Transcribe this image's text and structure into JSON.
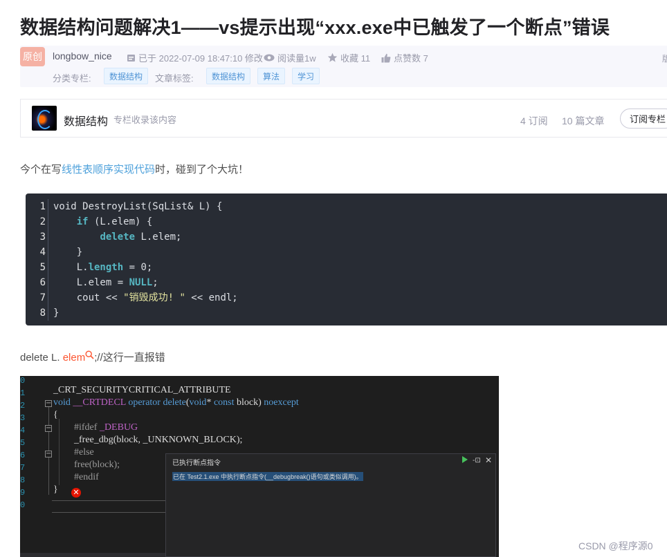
{
  "article": {
    "title": "数据结构问题解决1——vs提示出现“xxx.exe中已触发了一个断点”错误"
  },
  "meta": {
    "badge": "原创",
    "author": "longbow_nice",
    "date_label": "已于 2022-07-09 18:47:10 修改",
    "views_label": "阅读量1w",
    "favorites_label": "收藏 11",
    "likes_label": "点赞数 7",
    "edge_label": "版",
    "category_label": "分类专栏:",
    "categories": [
      "数据结构"
    ],
    "tags_label": "文章标签:",
    "tags": [
      "数据结构",
      "算法",
      "学习"
    ]
  },
  "column": {
    "name": "数据结构",
    "desc": "专栏收录该内容",
    "subscribers": "4 订阅",
    "articles": "10 篇文章",
    "subscribe_button": "订阅专栏"
  },
  "intro": {
    "prefix": "今个在写",
    "link": "线性表顺序实现代码",
    "suffix": "时，碰到了个大坑！"
  },
  "code": {
    "lines": [
      {
        "n": "1",
        "parts": [
          {
            "t": "void DestroyList(SqList& L) {",
            "c": ""
          }
        ]
      },
      {
        "n": "2",
        "parts": [
          {
            "t": "    ",
            "c": ""
          },
          {
            "t": "if",
            "c": "kw"
          },
          {
            "t": " (L.elem) {",
            "c": ""
          }
        ]
      },
      {
        "n": "3",
        "parts": [
          {
            "t": "        ",
            "c": ""
          },
          {
            "t": "delete",
            "c": "kw"
          },
          {
            "t": " L.elem;",
            "c": ""
          }
        ]
      },
      {
        "n": "4",
        "parts": [
          {
            "t": "    }",
            "c": ""
          }
        ]
      },
      {
        "n": "5",
        "parts": [
          {
            "t": "    L.",
            "c": ""
          },
          {
            "t": "length",
            "c": "kw"
          },
          {
            "t": " = 0;",
            "c": ""
          }
        ]
      },
      {
        "n": "6",
        "parts": [
          {
            "t": "    L.elem = ",
            "c": ""
          },
          {
            "t": "NULL",
            "c": "kw"
          },
          {
            "t": ";",
            "c": ""
          }
        ]
      },
      {
        "n": "7",
        "parts": [
          {
            "t": "    cout << ",
            "c": ""
          },
          {
            "t": "\"销毁成功! \"",
            "c": "str"
          },
          {
            "t": " << endl;",
            "c": ""
          }
        ]
      },
      {
        "n": "8",
        "parts": [
          {
            "t": "}",
            "c": ""
          }
        ]
      }
    ]
  },
  "note": {
    "prefix": "delete L. ",
    "keyword": "elem",
    "suffix": ";//这行一直报错"
  },
  "screenshot": {
    "line1": "_CRT_SECURITYCRITICAL_ATTRIBUTE",
    "line2_void": "void",
    "line2_macro": " __CRTDECL",
    "line2_op": " operator delete",
    "line2_rest_a": "(",
    "line2_void2": "void",
    "line2_rest_b": "* ",
    "line2_const": "const",
    "line2_rest_c": " block) ",
    "line2_noexcept": "noexcept",
    "line3": "{",
    "line4_pre": "#ifdef",
    "line4_macro": " _DEBUG",
    "line5": "_free_dbg(block, _UNKNOWN_BLOCK);",
    "line6": "#else",
    "line7": "free(block);",
    "line8": "#endif",
    "line9": "}",
    "popup_title": "已执行断点指令",
    "popup_message": "已在 Test2.1.exe 中执行断点指令(__debugbreak()语句或类似调用)。"
  },
  "watermark": "CSDN @程序源0"
}
